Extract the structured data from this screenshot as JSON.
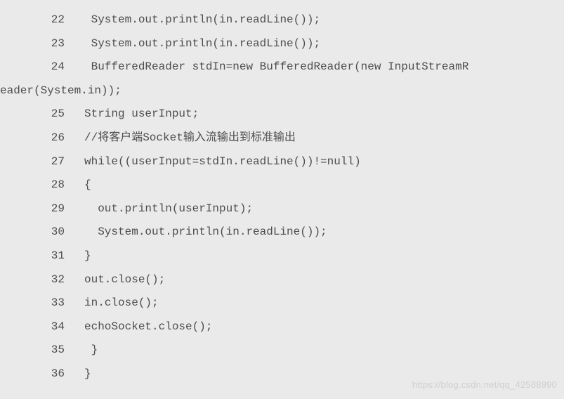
{
  "code": {
    "lines": [
      {
        "num": "22",
        "text": " System.out.println(in.readLine());"
      },
      {
        "num": "23",
        "text": " System.out.println(in.readLine());"
      },
      {
        "num": "24",
        "text": " BufferedReader stdIn=new BufferedReader(new InputStreamR"
      },
      {
        "num": "",
        "text": "eader(System.in));",
        "wrap": true
      },
      {
        "num": "25",
        "text": "String userInput;"
      },
      {
        "num": "26",
        "text": "//将客户端Socket输入流输出到标准输出"
      },
      {
        "num": "27",
        "text": "while((userInput=stdIn.readLine())!=null)"
      },
      {
        "num": "28",
        "text": "{"
      },
      {
        "num": "29",
        "text": "  out.println(userInput);"
      },
      {
        "num": "30",
        "text": "  System.out.println(in.readLine());"
      },
      {
        "num": "31",
        "text": "}"
      },
      {
        "num": "32",
        "text": "out.close();"
      },
      {
        "num": "33",
        "text": "in.close();"
      },
      {
        "num": "34",
        "text": "echoSocket.close();"
      },
      {
        "num": "35",
        "text": " }"
      },
      {
        "num": "36",
        "text": "}"
      }
    ]
  },
  "watermark": "https://blog.csdn.net/qq_42588990"
}
